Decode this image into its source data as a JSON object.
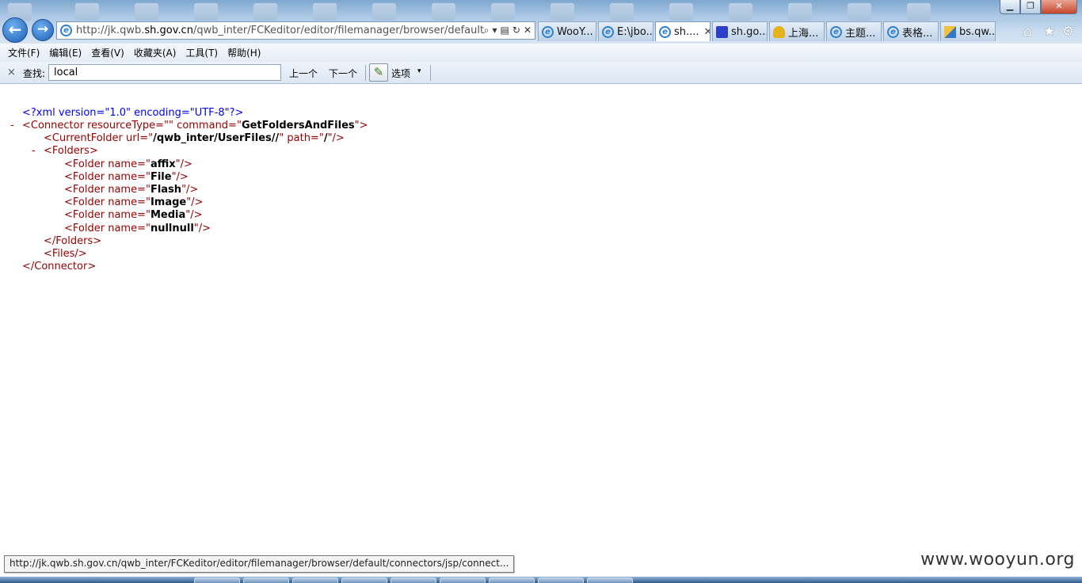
{
  "browser": {
    "window_controls": [
      "▁",
      "❐",
      "✕"
    ],
    "address": {
      "prefix": "http://jk.qwb.",
      "domain": "sh.gov.cn",
      "path": "/qwb_inter/FCKeditor/editor/filemanager/browser/default/con"
    },
    "tabs": [
      {
        "label": "WooY...",
        "icon": "ie-icon"
      },
      {
        "label": "E:\\jbo...",
        "icon": "ie-icon"
      },
      {
        "label": "sh....",
        "icon": "ie-icon",
        "active": true
      },
      {
        "label": "sh.go...",
        "icon": "paw-icon"
      },
      {
        "label": "上海...",
        "icon": "bell-icon"
      },
      {
        "label": "主题...",
        "icon": "ie-icon"
      },
      {
        "label": "表格...",
        "icon": "ie-icon"
      },
      {
        "label": "bs.qw...",
        "icon": "page-icon"
      }
    ],
    "tab_close": "✕",
    "right_icons": [
      "home-icon",
      "favorites-icon",
      "tools-gear-icon"
    ]
  },
  "menu": [
    "文件(F)",
    "编辑(E)",
    "查看(V)",
    "收藏夹(A)",
    "工具(T)",
    "帮助(H)"
  ],
  "findbar": {
    "close": "×",
    "label": "查找:",
    "value": "local",
    "prev": "上一个",
    "next": "下一个",
    "options": "选项",
    "caret": "▾"
  },
  "xml": {
    "toggle": "-",
    "lines": [
      {
        "segs": [
          [
            "pi",
            "<?xml version=\"1.0\" encoding=\"UTF-8\"?>"
          ]
        ]
      },
      {
        "segs": [
          [
            "t",
            "<Connector "
          ],
          [
            "an",
            "resourceType=\""
          ],
          [
            "av",
            ""
          ],
          [
            "q",
            "\" "
          ],
          [
            "an",
            "command=\""
          ],
          [
            "av",
            "GetFoldersAndFiles"
          ],
          [
            "q",
            "\">"
          ]
        ]
      },
      {
        "segs": [
          [
            "t",
            "<CurrentFolder "
          ],
          [
            "an",
            "url=\""
          ],
          [
            "av",
            "/qwb_inter/UserFiles//"
          ],
          [
            "q",
            "\" "
          ],
          [
            "an",
            "path=\""
          ],
          [
            "av",
            "/"
          ],
          [
            "q",
            "\"/>"
          ]
        ]
      },
      {
        "segs": [
          [
            "t",
            "<Folders>"
          ]
        ]
      },
      {
        "segs": [
          [
            "t",
            "<Folder "
          ],
          [
            "an",
            "name=\""
          ],
          [
            "av",
            "affix"
          ],
          [
            "q",
            "\"/>"
          ]
        ]
      },
      {
        "segs": [
          [
            "t",
            "<Folder "
          ],
          [
            "an",
            "name=\""
          ],
          [
            "av",
            "File"
          ],
          [
            "q",
            "\"/>"
          ]
        ]
      },
      {
        "segs": [
          [
            "t",
            "<Folder "
          ],
          [
            "an",
            "name=\""
          ],
          [
            "av",
            "Flash"
          ],
          [
            "q",
            "\"/>"
          ]
        ]
      },
      {
        "segs": [
          [
            "t",
            "<Folder "
          ],
          [
            "an",
            "name=\""
          ],
          [
            "av",
            "Image"
          ],
          [
            "q",
            "\"/>"
          ]
        ]
      },
      {
        "segs": [
          [
            "t",
            "<Folder "
          ],
          [
            "an",
            "name=\""
          ],
          [
            "av",
            "Media"
          ],
          [
            "q",
            "\"/>"
          ]
        ]
      },
      {
        "segs": [
          [
            "t",
            "<Folder "
          ],
          [
            "an",
            "name=\""
          ],
          [
            "av",
            "nullnull"
          ],
          [
            "q",
            "\"/>"
          ]
        ]
      },
      {
        "segs": [
          [
            "t",
            "</Folders>"
          ]
        ]
      },
      {
        "segs": [
          [
            "t",
            "<Files/>"
          ]
        ]
      },
      {
        "segs": [
          [
            "t",
            "</Connector>"
          ]
        ]
      }
    ]
  },
  "status_url": "http://jk.qwb.sh.gov.cn/qwb_inter/FCKeditor/editor/filemanager/browser/default/connectors/jsp/connect...",
  "watermark": "www.wooyun.org"
}
